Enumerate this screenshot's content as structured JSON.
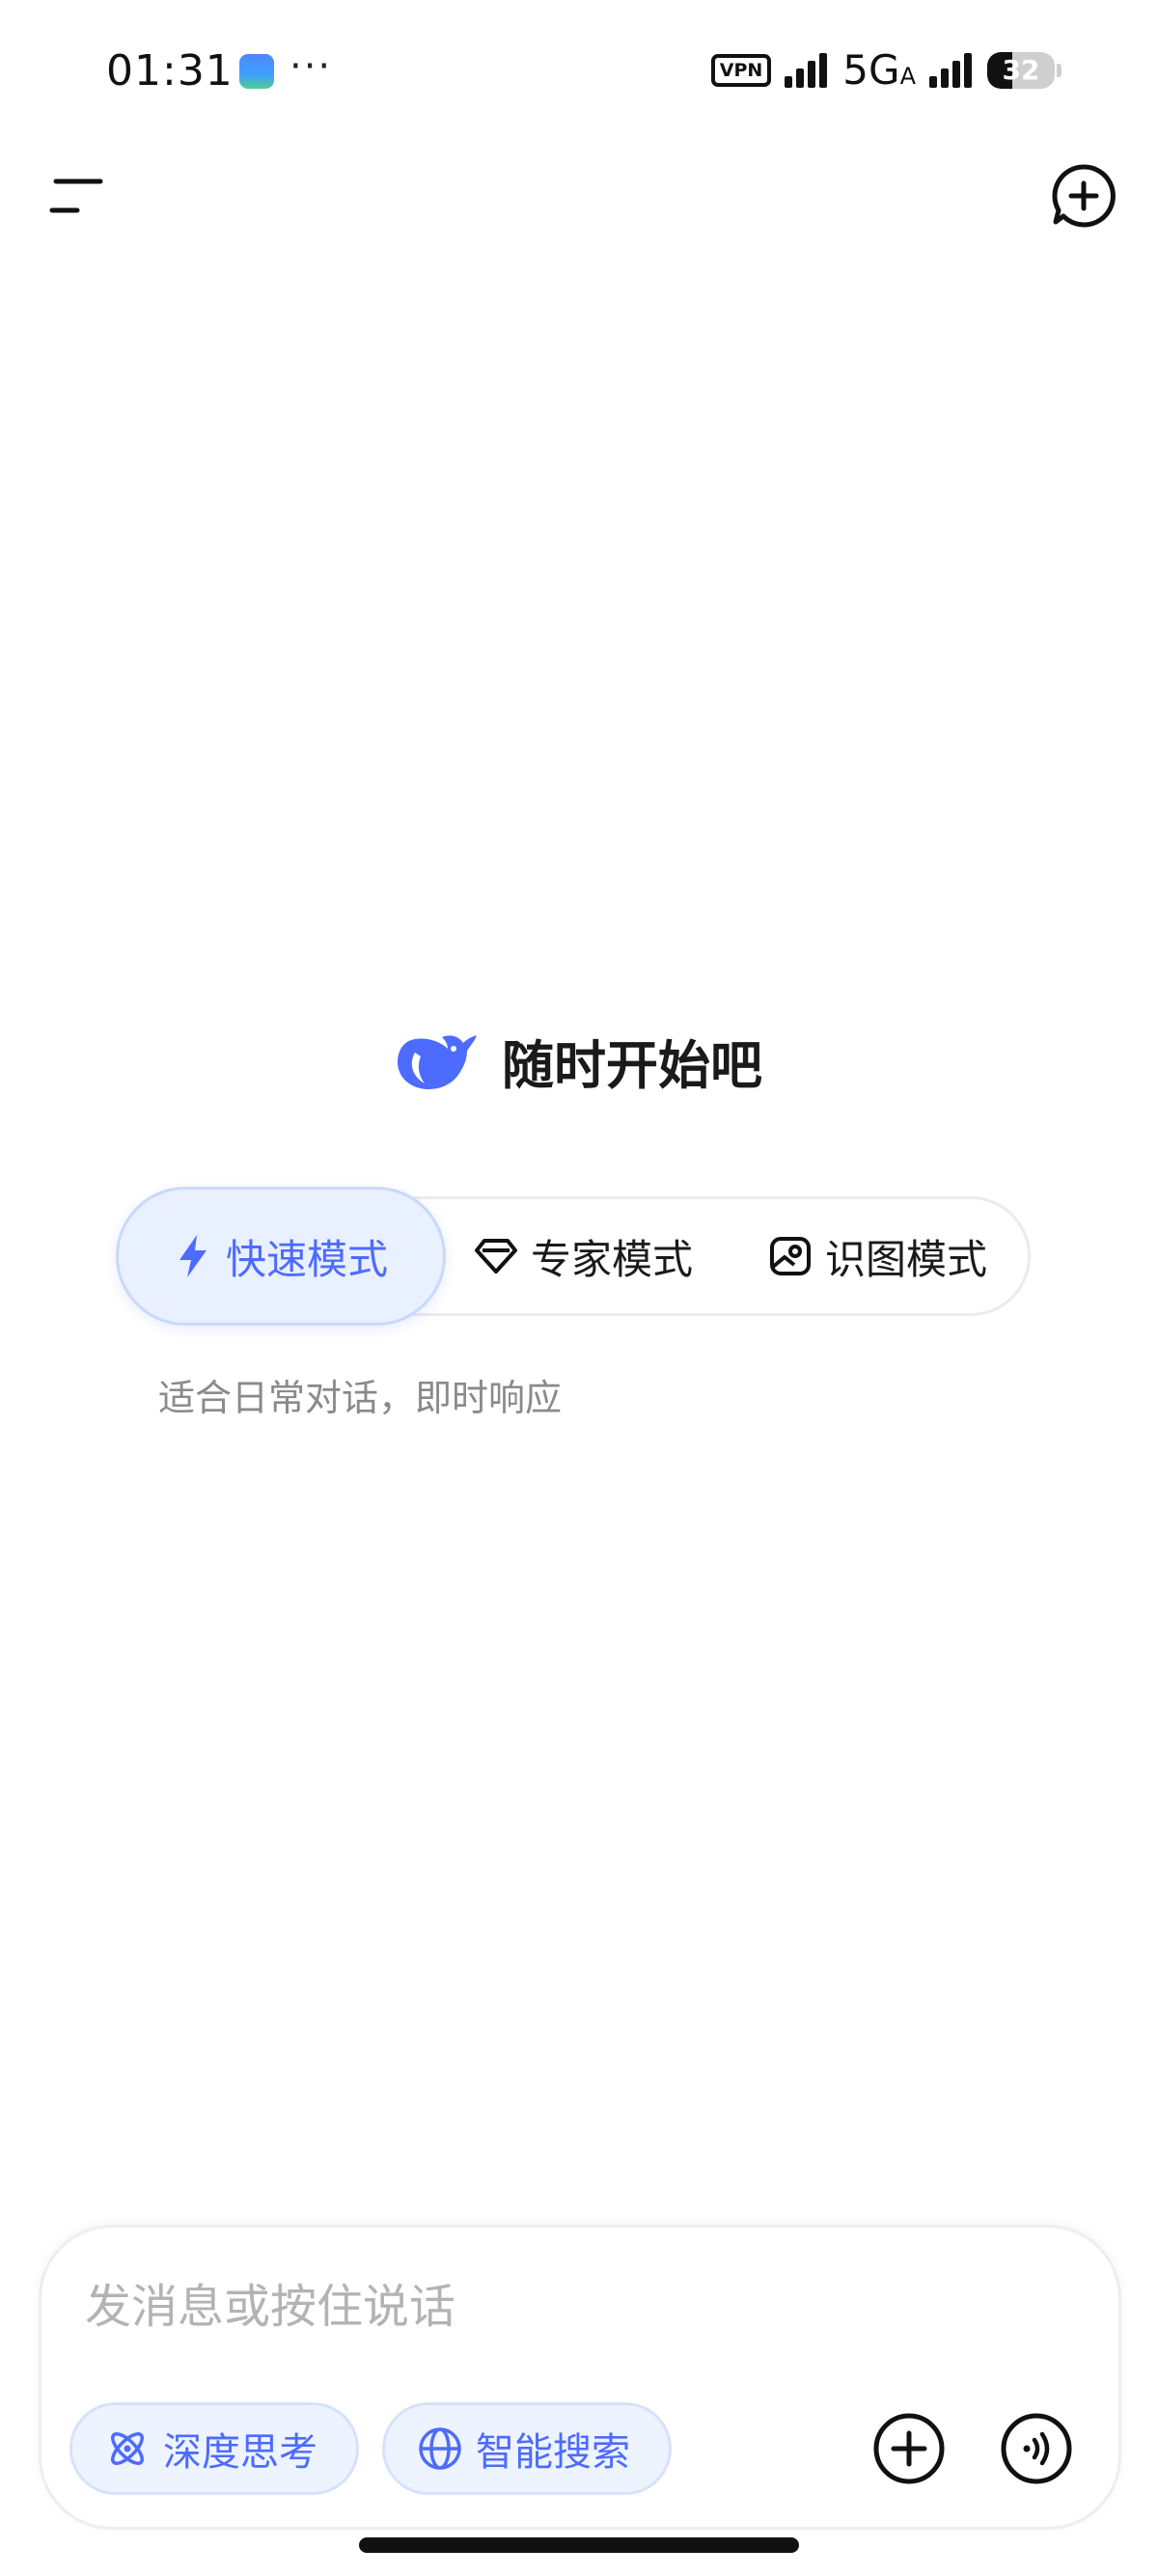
{
  "status_bar": {
    "time": "01:31",
    "dots": "···",
    "vpn": "VPN",
    "network": "5G",
    "network_sub": "A",
    "battery": "32"
  },
  "header": {
    "menu_icon": "menu-icon",
    "new_chat_icon": "new-chat-icon"
  },
  "greeting": {
    "logo_icon": "whale-logo-icon",
    "title": "随时开始吧"
  },
  "modes": {
    "items": [
      {
        "label": "快速模式",
        "icon": "lightning-icon",
        "active": true
      },
      {
        "label": "专家模式",
        "icon": "diamond-icon",
        "active": false
      },
      {
        "label": "识图模式",
        "icon": "image-icon",
        "active": false
      }
    ],
    "description": "适合日常对话，即时响应"
  },
  "composer": {
    "placeholder": "发消息或按住说话",
    "chips": [
      {
        "label": "深度思考",
        "icon": "atom-icon"
      },
      {
        "label": "智能搜索",
        "icon": "globe-icon"
      }
    ],
    "plus_icon": "plus-circle-icon",
    "voice_icon": "voice-wave-icon"
  },
  "colors": {
    "accent": "#4d6bfe",
    "chip_bg": "#edf3ff",
    "placeholder": "#b3b3b3",
    "description": "#8a8a8a"
  }
}
